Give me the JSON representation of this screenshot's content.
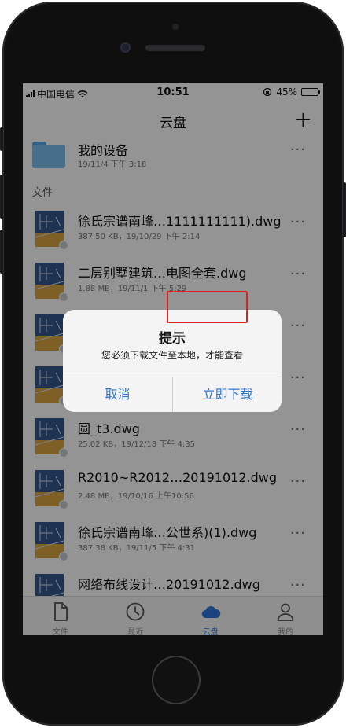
{
  "status_bar": {
    "carrier": "中国电信",
    "time": "10:51",
    "battery": "45%",
    "battery_level": 0.45
  },
  "nav": {
    "title": "云盘",
    "add_label": "+"
  },
  "device_folder": {
    "title": "我的设备",
    "meta": "19/11/4 下午 3:18"
  },
  "section_label": "文件",
  "files": [
    {
      "name": "徐氏宗谱南峰…1111111111).dwg",
      "meta": "387.50 KB，19/10/29 下午 2:14"
    },
    {
      "name": "二层别墅建筑…电图全套.dwg",
      "meta": "1.88 MB，19/11/1 下午 5:29"
    },
    {
      "name": "",
      "meta": ""
    },
    {
      "name": "",
      "meta": ""
    },
    {
      "name": "圆_t3.dwg",
      "meta": "25.02 KB，19/12/18 下午 4:35"
    },
    {
      "name": "R2010~R2012…20191012.dwg",
      "meta": "2.48 MB，19/10/16 上午10:56"
    },
    {
      "name": "徐氏宗谱南峰…公世系)(1).dwg",
      "meta": "387.38 KB，19/11/5 下午 4:31"
    },
    {
      "name": "网络布线设计…20191012.dwg",
      "meta": ""
    }
  ],
  "more_label": "···",
  "tabs": [
    {
      "label": "文件",
      "icon": "file-icon"
    },
    {
      "label": "最近",
      "icon": "clock-icon"
    },
    {
      "label": "云盘",
      "icon": "cloud-icon"
    },
    {
      "label": "我的",
      "icon": "person-icon"
    }
  ],
  "alert": {
    "title": "提示",
    "message": "您必须下载文件至本地，才能查看",
    "cancel_label": "取消",
    "confirm_label": "立即下载"
  },
  "colors": {
    "accent": "#2f74d8",
    "highlight": "#e02020",
    "dwg_blue": "#35578c",
    "dwg_gold": "#d9a441"
  }
}
